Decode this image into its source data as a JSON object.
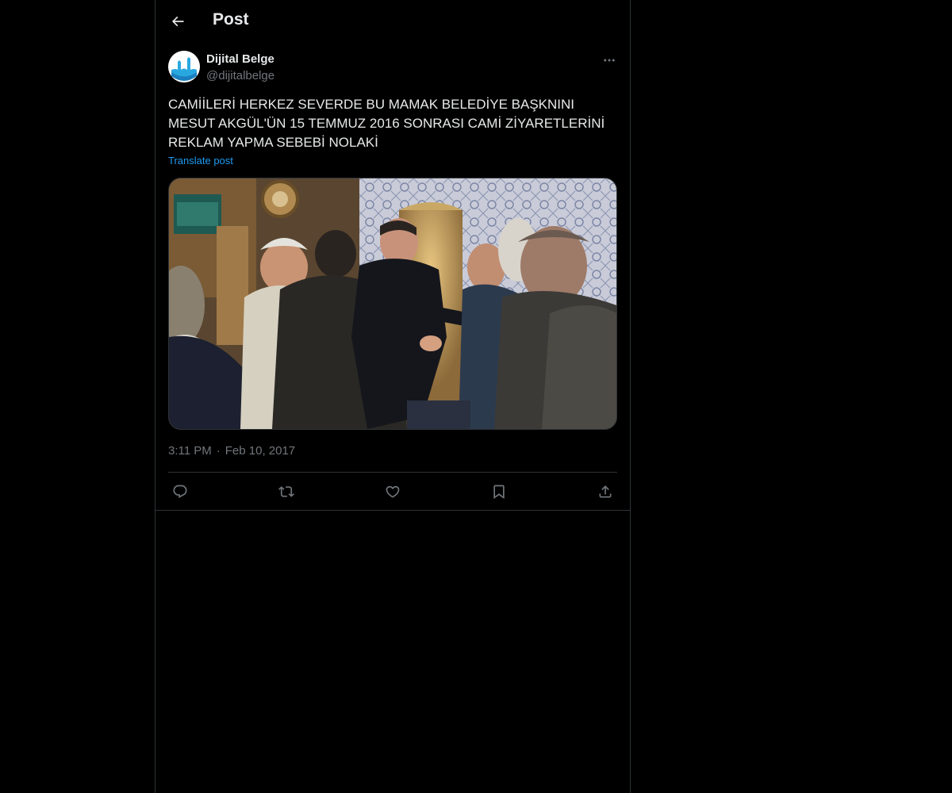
{
  "header": {
    "title": "Post",
    "back_icon": "arrow-left-icon"
  },
  "post": {
    "author": {
      "name": "Dijital Belge",
      "handle": "@dijitalbelge"
    },
    "more_icon": "more-horizontal-icon",
    "text": "CAMİİLERİ HERKEZ SEVERDE BU MAMAK BELEDİYE BAŞKNINI MESUT AKGÜL'ÜN 15 TEMMUZ 2016 SONRASI CAMİ ZİYARETLERİNİ REKLAM YAPMA SEBEBİ NOLAKİ",
    "translate_label": "Translate post",
    "time": "3:11 PM",
    "separator": "·",
    "date": "Feb 10, 2017",
    "actions": [
      {
        "name": "reply",
        "icon": "reply-icon"
      },
      {
        "name": "repost",
        "icon": "repost-icon"
      },
      {
        "name": "like",
        "icon": "heart-icon"
      },
      {
        "name": "bookmark",
        "icon": "bookmark-icon"
      },
      {
        "name": "share",
        "icon": "share-icon"
      }
    ]
  },
  "colors": {
    "background": "#000000",
    "text_primary": "#e7e9ea",
    "text_secondary": "#71767b",
    "link": "#1d9bf0",
    "border": "#2f3336"
  }
}
